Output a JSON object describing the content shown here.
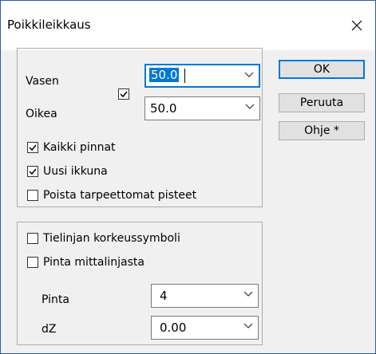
{
  "window": {
    "title": "Poikkileikkaus",
    "close_glyph": "✕"
  },
  "group1": {
    "vasen_label": "Vasen",
    "oikea_label": "Oikea",
    "vasen_value": "50.0",
    "oikea_value": "50.0",
    "link_checked": true,
    "kaikki_pinnat": {
      "label": "Kaikki pinnat",
      "checked": true
    },
    "uusi_ikkuna": {
      "label": "Uusi ikkuna",
      "checked": true
    },
    "poista": {
      "label": "Poista tarpeettomat pisteet",
      "checked": false
    }
  },
  "group2": {
    "tielinjan": {
      "label": "Tielinjan korkeussymboli",
      "checked": false
    },
    "pinta_mittalinjasta": {
      "label": "Pinta mittalinjasta",
      "checked": false
    },
    "pinta_label": "Pinta",
    "pinta_value": "4",
    "dz_label": "dZ",
    "dz_value": "0.00"
  },
  "buttons": {
    "ok": "OK",
    "cancel": "Peruuta",
    "help": "Ohje *"
  },
  "icons": {
    "close": "close-icon",
    "dropdown": "chevron-down-icon",
    "check": "checkmark-icon"
  },
  "colors": {
    "accent": "#0078d7",
    "dialog_bg": "#f0f0f0",
    "border": "#adadad"
  }
}
